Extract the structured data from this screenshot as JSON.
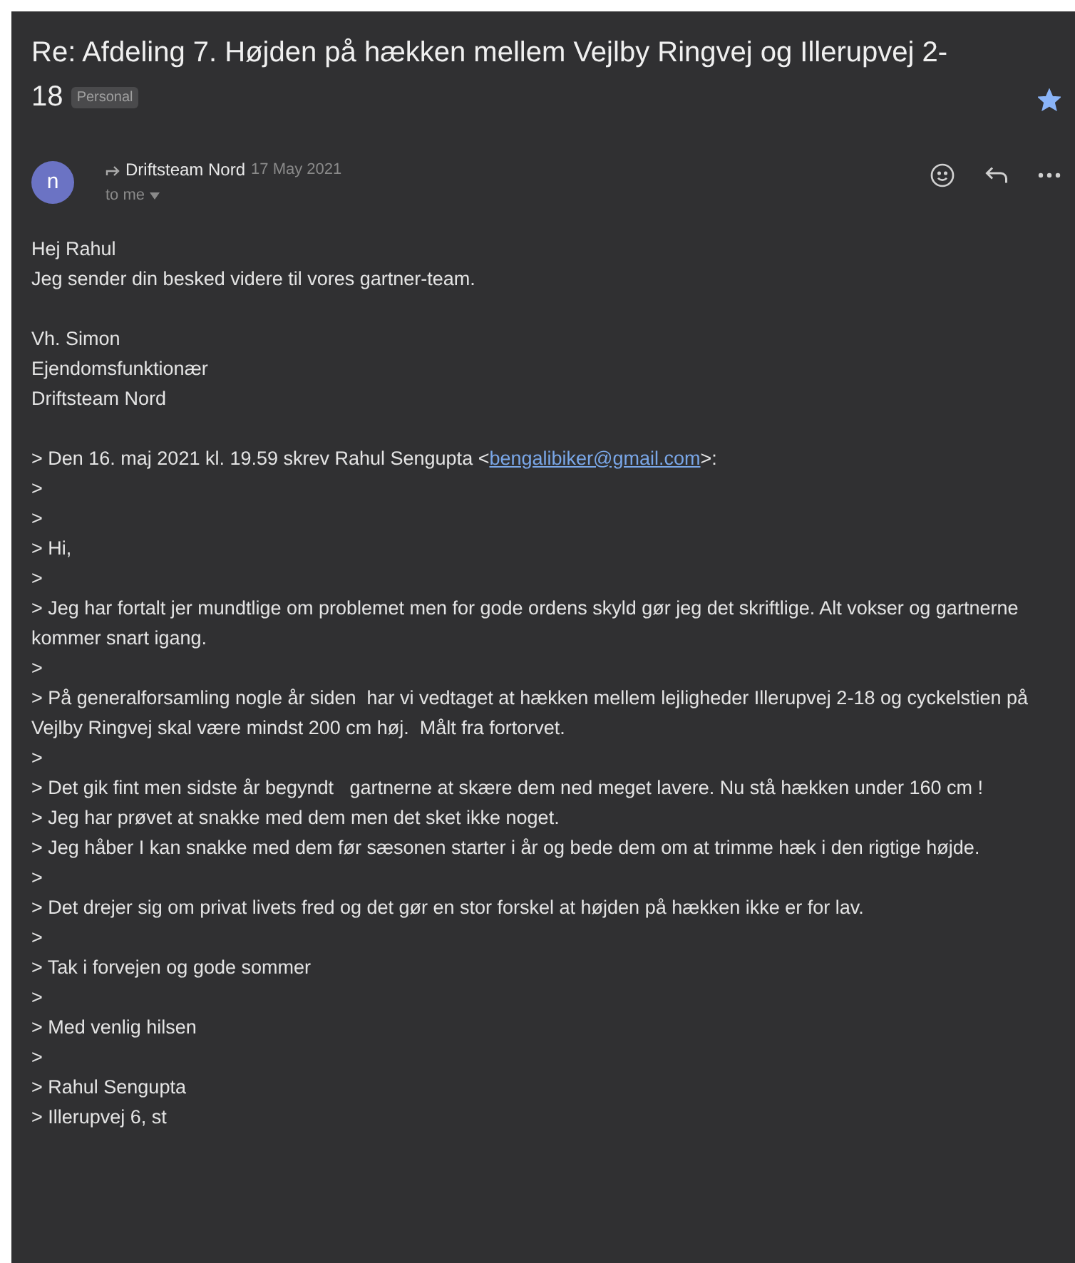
{
  "subject": {
    "title": "Re: Afdeling 7. Højden på hækken mellem Vejlby Ringvej og Illerupvej 2-18",
    "label": "Personal",
    "starred": true
  },
  "message": {
    "avatar": "n",
    "sender": "Driftsteam Nord",
    "date": "17 May 2021",
    "recipient": "to me"
  },
  "body": [
    {
      "kind": "block",
      "lines": [
        "Hej Rahul",
        "Jeg sender din besked videre til vores gartner-team."
      ]
    },
    {
      "kind": "block",
      "lines": [
        "Vh. Simon",
        "Ejendomsfunktionær",
        "Driftsteam Nord"
      ]
    },
    {
      "kind": "link_line",
      "before": "> Den 16. maj 2021 kl. 19.59 skrev Rahul Sengupta <",
      "link": "bengalibiker@gmail.com",
      "after": ">:"
    },
    {
      "kind": "block",
      "lines": [
        ">",
        ">",
        "> Hi,",
        ">",
        "> Jeg har fortalt jer mundtlige om problemet men for gode ordens skyld gør jeg det skriftlige. Alt vokser og gartnerne kommer snart igang.",
        ">",
        "> På generalforsamling nogle år siden  har vi vedtaget at hækken mellem lejligheder Illerupvej 2-18 og cyckelstien på Vejlby Ringvej skal være mindst 200 cm høj.  Målt fra fortorvet.",
        ">",
        "> Det gik fint men sidste år begyndt   gartnerne at skære dem ned meget lavere. Nu stå hækken under 160 cm !",
        "> Jeg har prøvet at snakke med dem men det sket ikke noget.",
        "> Jeg håber I kan snakke med dem før sæsonen starter i år og bede dem om at trimme hæk i den rigtige højde.",
        ">",
        "> Det drejer sig om privat livets fred og det gør en stor forskel at højden på hækken ikke er for lav.",
        ">",
        "> Tak i forvejen og gode sommer",
        ">",
        "> Med venlig hilsen",
        ">",
        "> Rahul Sengupta",
        "> Illerupvej 6, st"
      ]
    }
  ]
}
